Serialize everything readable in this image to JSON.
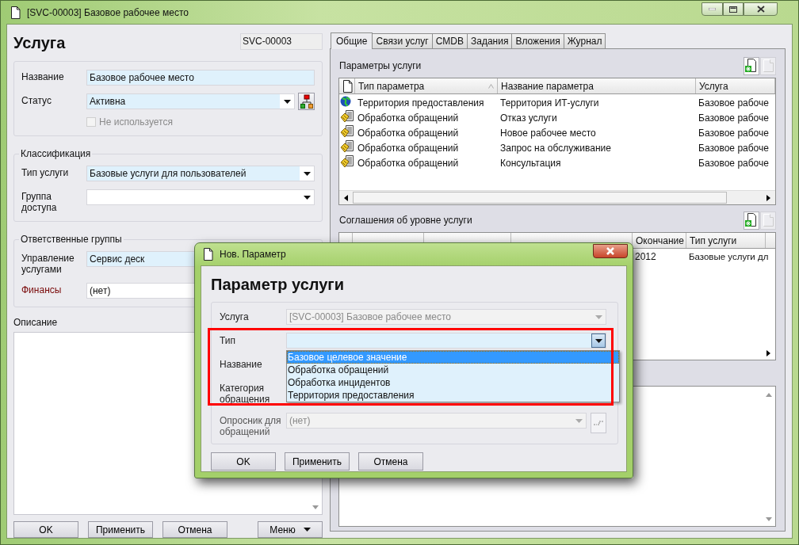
{
  "window": {
    "title": "[SVC-00003] Базовое рабочее место"
  },
  "service_form": {
    "heading": "Услуга",
    "id": "SVC-00003",
    "main_fields": [
      {
        "label": "Название",
        "value": "Базовое рабочее место",
        "kind": "text",
        "required": true
      },
      {
        "label": "Статус",
        "value": "Активна",
        "kind": "combo",
        "required": true
      }
    ],
    "unused": {
      "label": "Не используется",
      "checked": false,
      "disabled": true
    },
    "groups": [
      {
        "title": "Классификация",
        "fields": [
          {
            "label": "Тип услуги",
            "value": "Базовые услуги для пользователей",
            "required": true,
            "warning": false
          },
          {
            "label": "Группа доступа",
            "required": false,
            "warning": false
          }
        ]
      },
      {
        "title": "Ответственные группы",
        "fields": [
          {
            "label": "Управление услугами",
            "value": "Сервис деск",
            "required": true,
            "warning": false
          },
          {
            "label": "Финансы",
            "value": "(нет)",
            "required": false,
            "warning": true
          }
        ]
      }
    ],
    "description": {
      "label": "Описание"
    },
    "buttons": [
      "OK",
      "Применить",
      "Отмена"
    ],
    "menu_button": "Меню"
  },
  "tabs": [
    {
      "label": "Общие",
      "selected": true
    },
    {
      "label": "Связи услуг",
      "selected": false
    },
    {
      "label": "CMDB",
      "selected": false
    },
    {
      "label": "Задания",
      "selected": false
    },
    {
      "label": "Вложения",
      "selected": false
    },
    {
      "label": "Журнал",
      "selected": false
    }
  ],
  "parameters": {
    "title": "Параметры услуги",
    "columns": [
      "Тип параметра",
      "Название параметра",
      "Услуга"
    ],
    "rows": [
      {
        "kind": "globe",
        "cells": [
          "Территория предоставления",
          "Территория ИТ-услуги",
          "Базовое рабоче"
        ]
      },
      {
        "kind": "handshake",
        "cells": [
          "Обработка обращений",
          "Отказ услуги",
          "Базовое рабоче"
        ]
      },
      {
        "kind": "handshake",
        "cells": [
          "Обработка обращений",
          "Новое рабочее место",
          "Базовое рабоче"
        ]
      },
      {
        "kind": "handshake",
        "cells": [
          "Обработка обращений",
          "Запрос на обслуживание",
          "Базовое рабоче"
        ]
      },
      {
        "kind": "handshake",
        "cells": [
          "Обработка обращений",
          "Консультация",
          "Базовое рабоче"
        ]
      }
    ]
  },
  "agreements": {
    "title": "Соглашения об уровне услуги",
    "columns": [
      "Окончание",
      "Тип услуги"
    ],
    "rows": [
      {
        "cells": [
          "2012",
          "Базовые услуги дл"
        ]
      }
    ]
  },
  "dialog": {
    "title": "Нов. Параметр",
    "heading": "Параметр услуги",
    "service": {
      "label": "Услуга",
      "value": "[SVC-00003] Базовое рабочее место",
      "disabled": true
    },
    "type": {
      "label": "Тип",
      "expanded": true,
      "highlighted": true,
      "options": [
        {
          "label": "Базовое целевое значение",
          "selected": true
        },
        {
          "label": "Обработка обращений",
          "selected": false
        },
        {
          "label": "Обработка инцидентов",
          "selected": false
        },
        {
          "label": "Территория предоставления",
          "selected": false
        }
      ]
    },
    "name_label": "Название",
    "category_label": "Категория обращения",
    "questionnaire": {
      "label": "Опросник для обращений",
      "value": "(нет)",
      "disabled": true
    },
    "buttons": [
      "OK",
      "Применить",
      "Отмена"
    ]
  }
}
